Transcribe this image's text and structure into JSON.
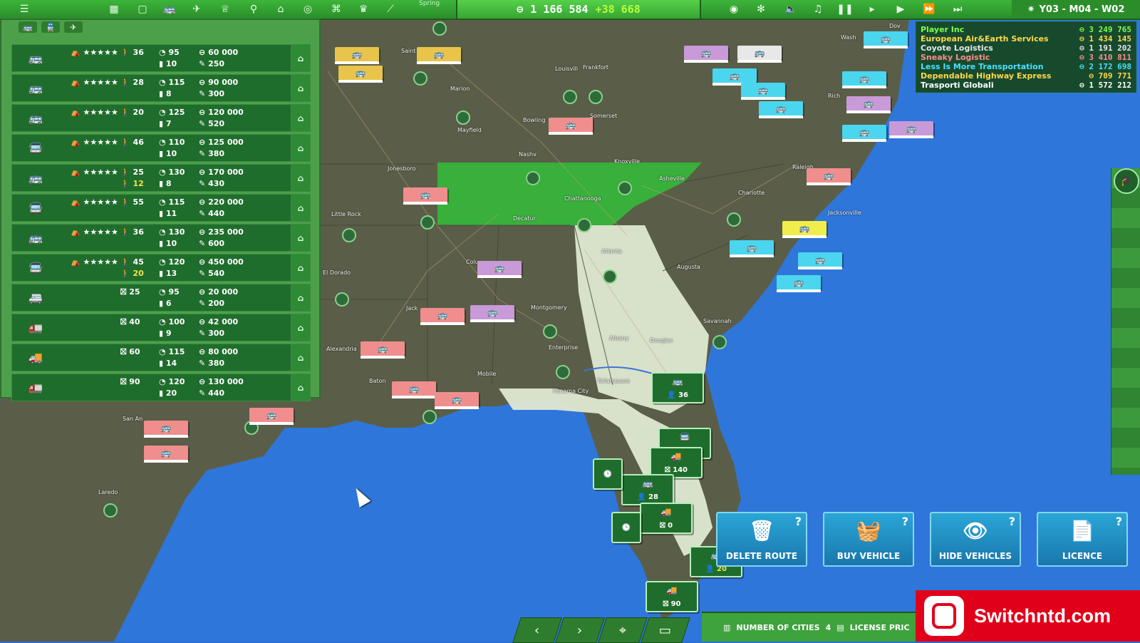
{
  "topbar": {
    "season": "Spring",
    "money": "1 166 584",
    "money_gain": "+38 668",
    "date": "Y03 - M04 - W02",
    "icons": [
      "menu-icon",
      "bus-depot-icon",
      "bank-icon",
      "bus-icon",
      "train-icon",
      "trophy-icon",
      "person-icon",
      "building-icon",
      "globe-icon",
      "factory-icon",
      "cup-icon",
      "chart-icon"
    ],
    "media_icons": [
      "eye-icon",
      "settings-icon",
      "volume-icon",
      "music-icon",
      "pause-icon",
      "step-icon",
      "play-icon",
      "fast-forward-icon",
      "fastest-icon"
    ]
  },
  "leaderboard": [
    {
      "name": "Player Inc",
      "value": "3 249 765",
      "color": "#7dff4a"
    },
    {
      "name": "European Air&Earth Services",
      "value": "1 434 145",
      "color": "#ffd84a"
    },
    {
      "name": "Coyote Logistics",
      "value": "1 191 202",
      "color": "#e8e8e8"
    },
    {
      "name": "Sneaky Logistic",
      "value": "3 410 811",
      "color": "#ff8c8c"
    },
    {
      "name": "Less Is More Transportation",
      "value": "2 172 698",
      "color": "#4ae0ff"
    },
    {
      "name": "Dependable Highway Express",
      "value": "709 771",
      "color": "#ffd84a"
    },
    {
      "name": "Trasporti Globali",
      "value": "1 572 212",
      "color": "#ffffff"
    }
  ],
  "vehicle_tabs": [
    "bus-tab",
    "train-tab",
    "plane-tab"
  ],
  "vehicles": [
    {
      "stars": "★★★★★",
      "seats": "36",
      "speed": "95",
      "price": "60 000",
      "fuel": "10",
      "maint": "250"
    },
    {
      "stars": "★★★★★",
      "seats": "28",
      "speed": "115",
      "price": "90 000",
      "fuel": "8",
      "maint": "300"
    },
    {
      "stars": "★★★★★",
      "seats": "20",
      "speed": "125",
      "price": "120 000",
      "fuel": "7",
      "maint": "520"
    },
    {
      "stars": "★★★★★",
      "seats": "46",
      "speed": "110",
      "price": "125 000",
      "fuel": "10",
      "maint": "380"
    },
    {
      "stars": "★★★★★",
      "seats": "25",
      "seats2": "12",
      "speed": "130",
      "price": "170 000",
      "fuel": "8",
      "maint": "430"
    },
    {
      "stars": "★★★★★",
      "seats": "55",
      "speed": "115",
      "price": "220 000",
      "fuel": "11",
      "maint": "440"
    },
    {
      "stars": "★★★★★",
      "seats": "36",
      "speed": "130",
      "price": "235 000",
      "fuel": "10",
      "maint": "600"
    },
    {
      "stars": "★★★★★",
      "seats": "45",
      "seats2": "20",
      "speed": "120",
      "price": "450 000",
      "fuel": "13",
      "maint": "540"
    },
    {
      "stars": "",
      "seats": "25",
      "speed": "95",
      "price": "20 000",
      "fuel": "6",
      "maint": "200"
    },
    {
      "stars": "",
      "seats": "40",
      "speed": "100",
      "price": "42 000",
      "fuel": "9",
      "maint": "300"
    },
    {
      "stars": "",
      "seats": "60",
      "speed": "115",
      "price": "80 000",
      "fuel": "14",
      "maint": "380"
    },
    {
      "stars": "",
      "seats": "90",
      "speed": "120",
      "price": "130 000",
      "fuel": "20",
      "maint": "440"
    }
  ],
  "cities": [
    "Saint",
    "Louisvill",
    "Frankfort",
    "Marion",
    "Mayfield",
    "Bowling",
    "Somerset",
    "Nashv",
    "Knoxville",
    "Jonesboro",
    "Asheville",
    "Chattanooga",
    "Little Rock",
    "Decatur",
    "Raleigh",
    "Charlotte",
    "Jacksonville",
    "Atlanta",
    "Colu",
    "Augusta",
    "El Dorado",
    "Montgomery",
    "Jack",
    "Savannah",
    "Albany",
    "Douglas",
    "Alexandria",
    "Enterprise",
    "Mobile",
    "Baton",
    "Tallahassee",
    "Panama City",
    "Rich",
    "Wash",
    "Dov",
    "San An",
    "Laredo",
    "Columbia"
  ],
  "vehicle_cards": [
    "36",
    "140",
    "140",
    "28",
    "0",
    "20",
    "90"
  ],
  "actions": [
    {
      "label": "DELETE ROUTE",
      "icon": "trash-route-icon"
    },
    {
      "label": "BUY VEHICLE",
      "icon": "basket-icon"
    },
    {
      "label": "HIDE VEHICLES",
      "icon": "eye-bus-icon"
    },
    {
      "label": "LICENCE",
      "icon": "document-icon"
    }
  ],
  "infobar": {
    "cities_label": "NUMBER OF CITIES",
    "cities_value": "4",
    "license_label": "LICENSE PRIC"
  },
  "logo": "Switchntd.com"
}
